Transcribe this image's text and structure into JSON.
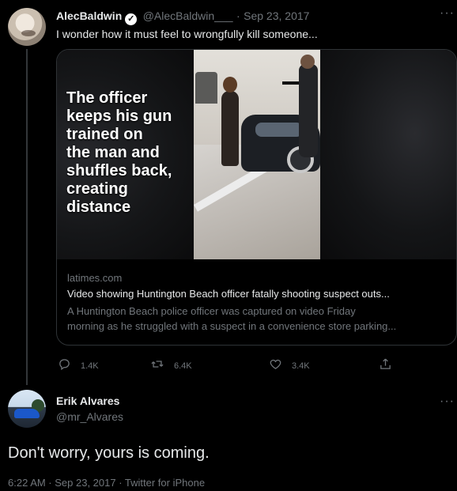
{
  "tweet": {
    "name": "AlecBaldwin",
    "handle": "@AlecBaldwin___",
    "separator": "·",
    "date": "Sep 23, 2017",
    "text": "I wonder how it must feel to wrongfully kill someone...",
    "more": "···",
    "card": {
      "overlay_lines": [
        "The officer",
        "keeps his gun",
        "trained on",
        "the man and",
        "shuffles back,",
        "creating",
        "distance"
      ],
      "domain": "latimes.com",
      "title": "Video showing Huntington Beach officer fatally shooting suspect outs...",
      "desc_lines": [
        "A Huntington Beach police officer was captured on video Friday",
        "morning as he struggled with a suspect in a convenience store parking..."
      ]
    },
    "actions": {
      "reply_count": "1.4K",
      "retweet_count": "6.4K",
      "like_count": "3.4K"
    }
  },
  "reply": {
    "name": "Erik Alvares",
    "handle": "@mr_Alvares",
    "more": "···",
    "text": "Don't worry, yours is coming.",
    "footer": "6:22 AM · Sep 23, 2017 · Twitter for iPhone"
  },
  "icons": {
    "verified": "verified-badge-icon",
    "reply": "reply-icon",
    "retweet": "retweet-icon",
    "like": "heart-icon",
    "share": "share-icon"
  },
  "colors": {
    "background": "#000000",
    "text": "#e7e9ea",
    "muted": "#71767b",
    "border": "#2f3336"
  }
}
